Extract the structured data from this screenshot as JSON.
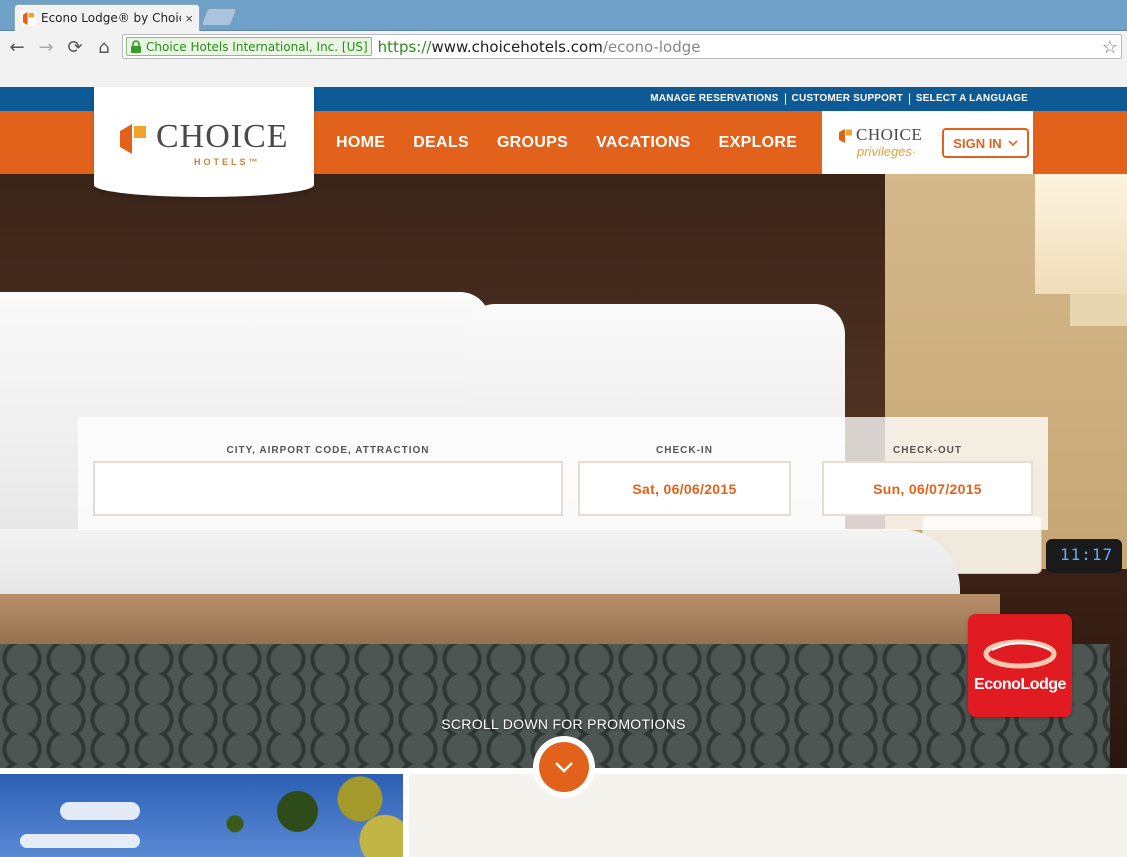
{
  "browser": {
    "tab_title": "Econo Lodge® by Choice",
    "tab_close": "×",
    "back_glyph": "←",
    "forward_glyph": "→",
    "reload_glyph": "⟳",
    "home_glyph": "⌂",
    "ev_cert": "Choice Hotels International, Inc. [US]",
    "url_scheme": "https://",
    "url_host": "www.choicehotels.com",
    "url_path": "/econo-lodge",
    "star_glyph": "☆"
  },
  "utility_nav": [
    "MANAGE RESERVATIONS",
    "CUSTOMER SUPPORT",
    "SELECT A LANGUAGE"
  ],
  "logo": {
    "word": "CHOICE",
    "sub": "HOTELS™"
  },
  "main_nav": [
    "HOME",
    "DEALS",
    "GROUPS",
    "VACATIONS",
    "EXPLORE"
  ],
  "privileges": {
    "word": "CHOICE",
    "sub": "privileges·"
  },
  "sign_in": "SIGN IN",
  "search": {
    "destination_label": "CITY, AIRPORT CODE, ATTRACTION",
    "destination_value": "",
    "checkin_label": "CHECK-IN",
    "checkin_value": "Sat, 06/06/2015",
    "checkout_label": "CHECK-OUT",
    "checkout_value": "Sun, 06/07/2015"
  },
  "brand_badge": "EconoLodge",
  "clock_display": "11:17",
  "scroll_prompt": "SCROLL DOWN FOR PROMOTIONS",
  "colors": {
    "brand_orange": "#e2621c",
    "brand_blue": "#0d5a96",
    "econo_red": "#e01b22"
  }
}
